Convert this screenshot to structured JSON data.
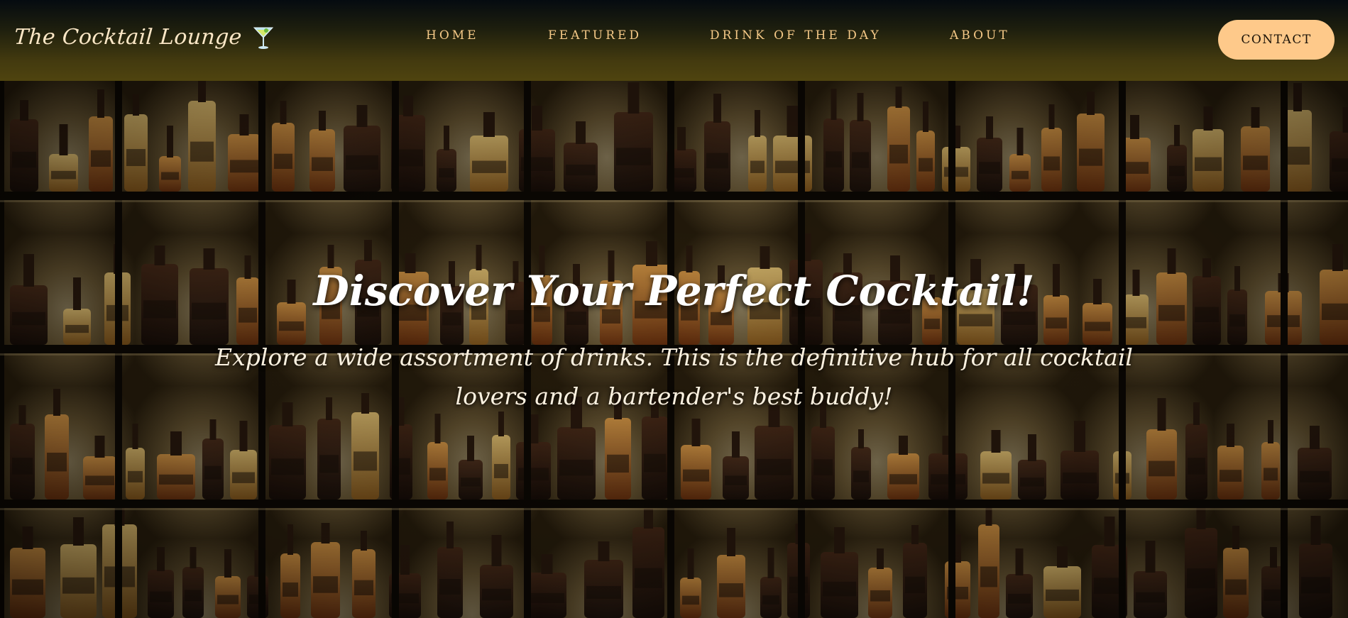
{
  "brand": {
    "name": "The Cocktail Lounge",
    "icon": "cocktail-glass-icon"
  },
  "nav": {
    "items": [
      {
        "label": "HOME"
      },
      {
        "label": "FEATURED"
      },
      {
        "label": "DRINK OF THE DAY"
      },
      {
        "label": "ABOUT"
      }
    ],
    "contact_label": "CONTACT"
  },
  "hero": {
    "title": "Discover Your Perfect Cocktail!",
    "subtitle": "Explore a wide assortment of drinks. This is the definitive hub for all cocktail lovers and a bartender's best buddy!",
    "background": "backlit-bar-shelves-with-liquor-bottles"
  },
  "colors": {
    "nav_link": "#f5c987",
    "brand_text": "#fbe7c6",
    "contact_button_bg": "#fec98a",
    "hero_text": "#ffffff"
  }
}
